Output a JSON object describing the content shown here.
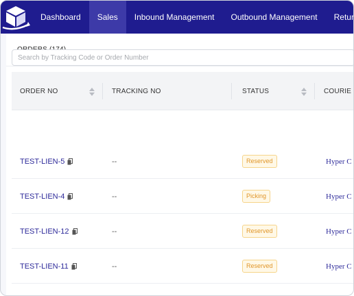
{
  "nav": {
    "logo_icon": "box-with-arrow-icon",
    "items": [
      {
        "label": "Dashboard",
        "active": false
      },
      {
        "label": "Sales",
        "active": true
      },
      {
        "label": "Inbound Management",
        "active": false
      },
      {
        "label": "Outbound Management",
        "active": false
      },
      {
        "label": "Return Man",
        "active": false
      }
    ]
  },
  "orders": {
    "title": "ORDERS (174)",
    "search_placeholder": "Search by Tracking Code or Order Number"
  },
  "table": {
    "columns": [
      "ORDER NO",
      "TRACKING NO",
      "STATUS",
      "COURIE"
    ],
    "rows": [
      {
        "order_no": "TEST-LIEN-5",
        "tracking_no": "--",
        "status": "Reserved",
        "courier": "Hyper C"
      },
      {
        "order_no": "TEST-LIEN-4",
        "tracking_no": "--",
        "status": "Picking",
        "courier": "Hyper C"
      },
      {
        "order_no": "TEST-LIEN-12",
        "tracking_no": "--",
        "status": "Reserved",
        "courier": "Hyper C"
      },
      {
        "order_no": "TEST-LIEN-11",
        "tracking_no": "--",
        "status": "Reserved",
        "courier": "Hyper C"
      }
    ]
  },
  "colors": {
    "nav_bg": "#1f1c8f",
    "nav_active": "#3d3aa8",
    "link": "#2d2a9a",
    "badge_text": "#e0962a",
    "badge_border": "#f6d48a",
    "badge_bg": "#fff8e6"
  }
}
